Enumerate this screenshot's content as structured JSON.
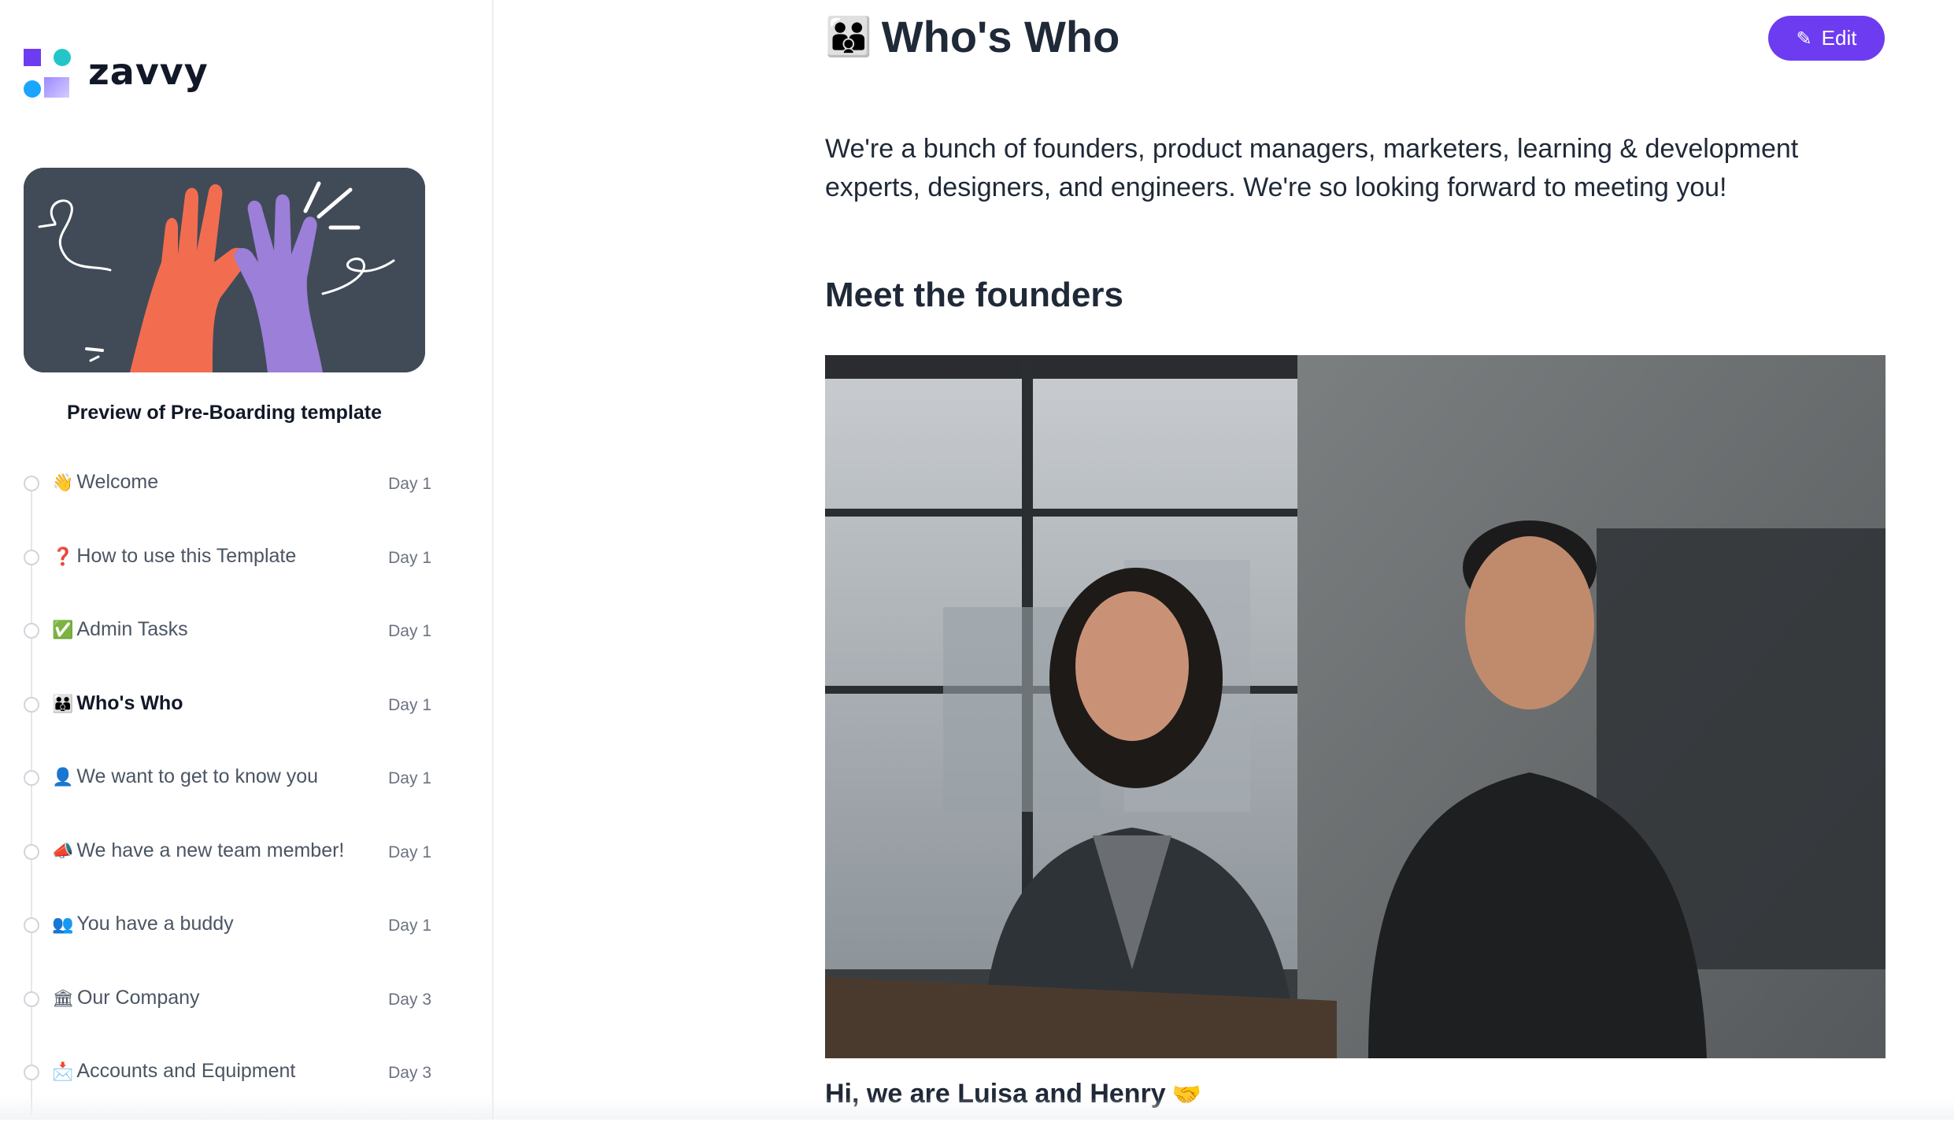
{
  "app": {
    "name": "zavvy"
  },
  "sidebar": {
    "preview_title": "Preview of Pre-Boarding template",
    "steps": [
      {
        "icon": "👋",
        "label": "Welcome",
        "day": "Day 1",
        "active": false
      },
      {
        "icon": "❓",
        "label": "How to use this Template",
        "day": "Day 1",
        "active": false
      },
      {
        "icon": "✅",
        "label": "Admin Tasks",
        "day": "Day 1",
        "active": false
      },
      {
        "icon": "👪",
        "label": "Who's Who",
        "day": "Day 1",
        "active": true
      },
      {
        "icon": "👤",
        "label": "We want to get to know you",
        "day": "Day 1",
        "active": false
      },
      {
        "icon": "📣",
        "label": "We have a new team member!",
        "day": "Day 1",
        "active": false
      },
      {
        "icon": "👥",
        "label": "You have a buddy",
        "day": "Day 1",
        "active": false
      },
      {
        "icon": "🏛",
        "label": "Our Company",
        "day": "Day 3",
        "active": false
      },
      {
        "icon": "📩",
        "label": "Accounts and Equipment",
        "day": "Day 3",
        "active": false
      }
    ]
  },
  "main": {
    "title_icon": "👪",
    "title": "Who's Who",
    "edit_label": "Edit",
    "intro": "We're a bunch of founders, product managers, marketers, learning & development experts, designers, and engineers. We're so looking forward to meeting you!",
    "section_heading": "Meet the founders",
    "caption": "Hi, we are Luisa and Henry",
    "caption_icon": "🤝"
  },
  "colors": {
    "accent": "#6d3cf0",
    "hero_bg": "#414b57",
    "hand_left": "#f26d50",
    "hand_right": "#9b7fd9"
  }
}
